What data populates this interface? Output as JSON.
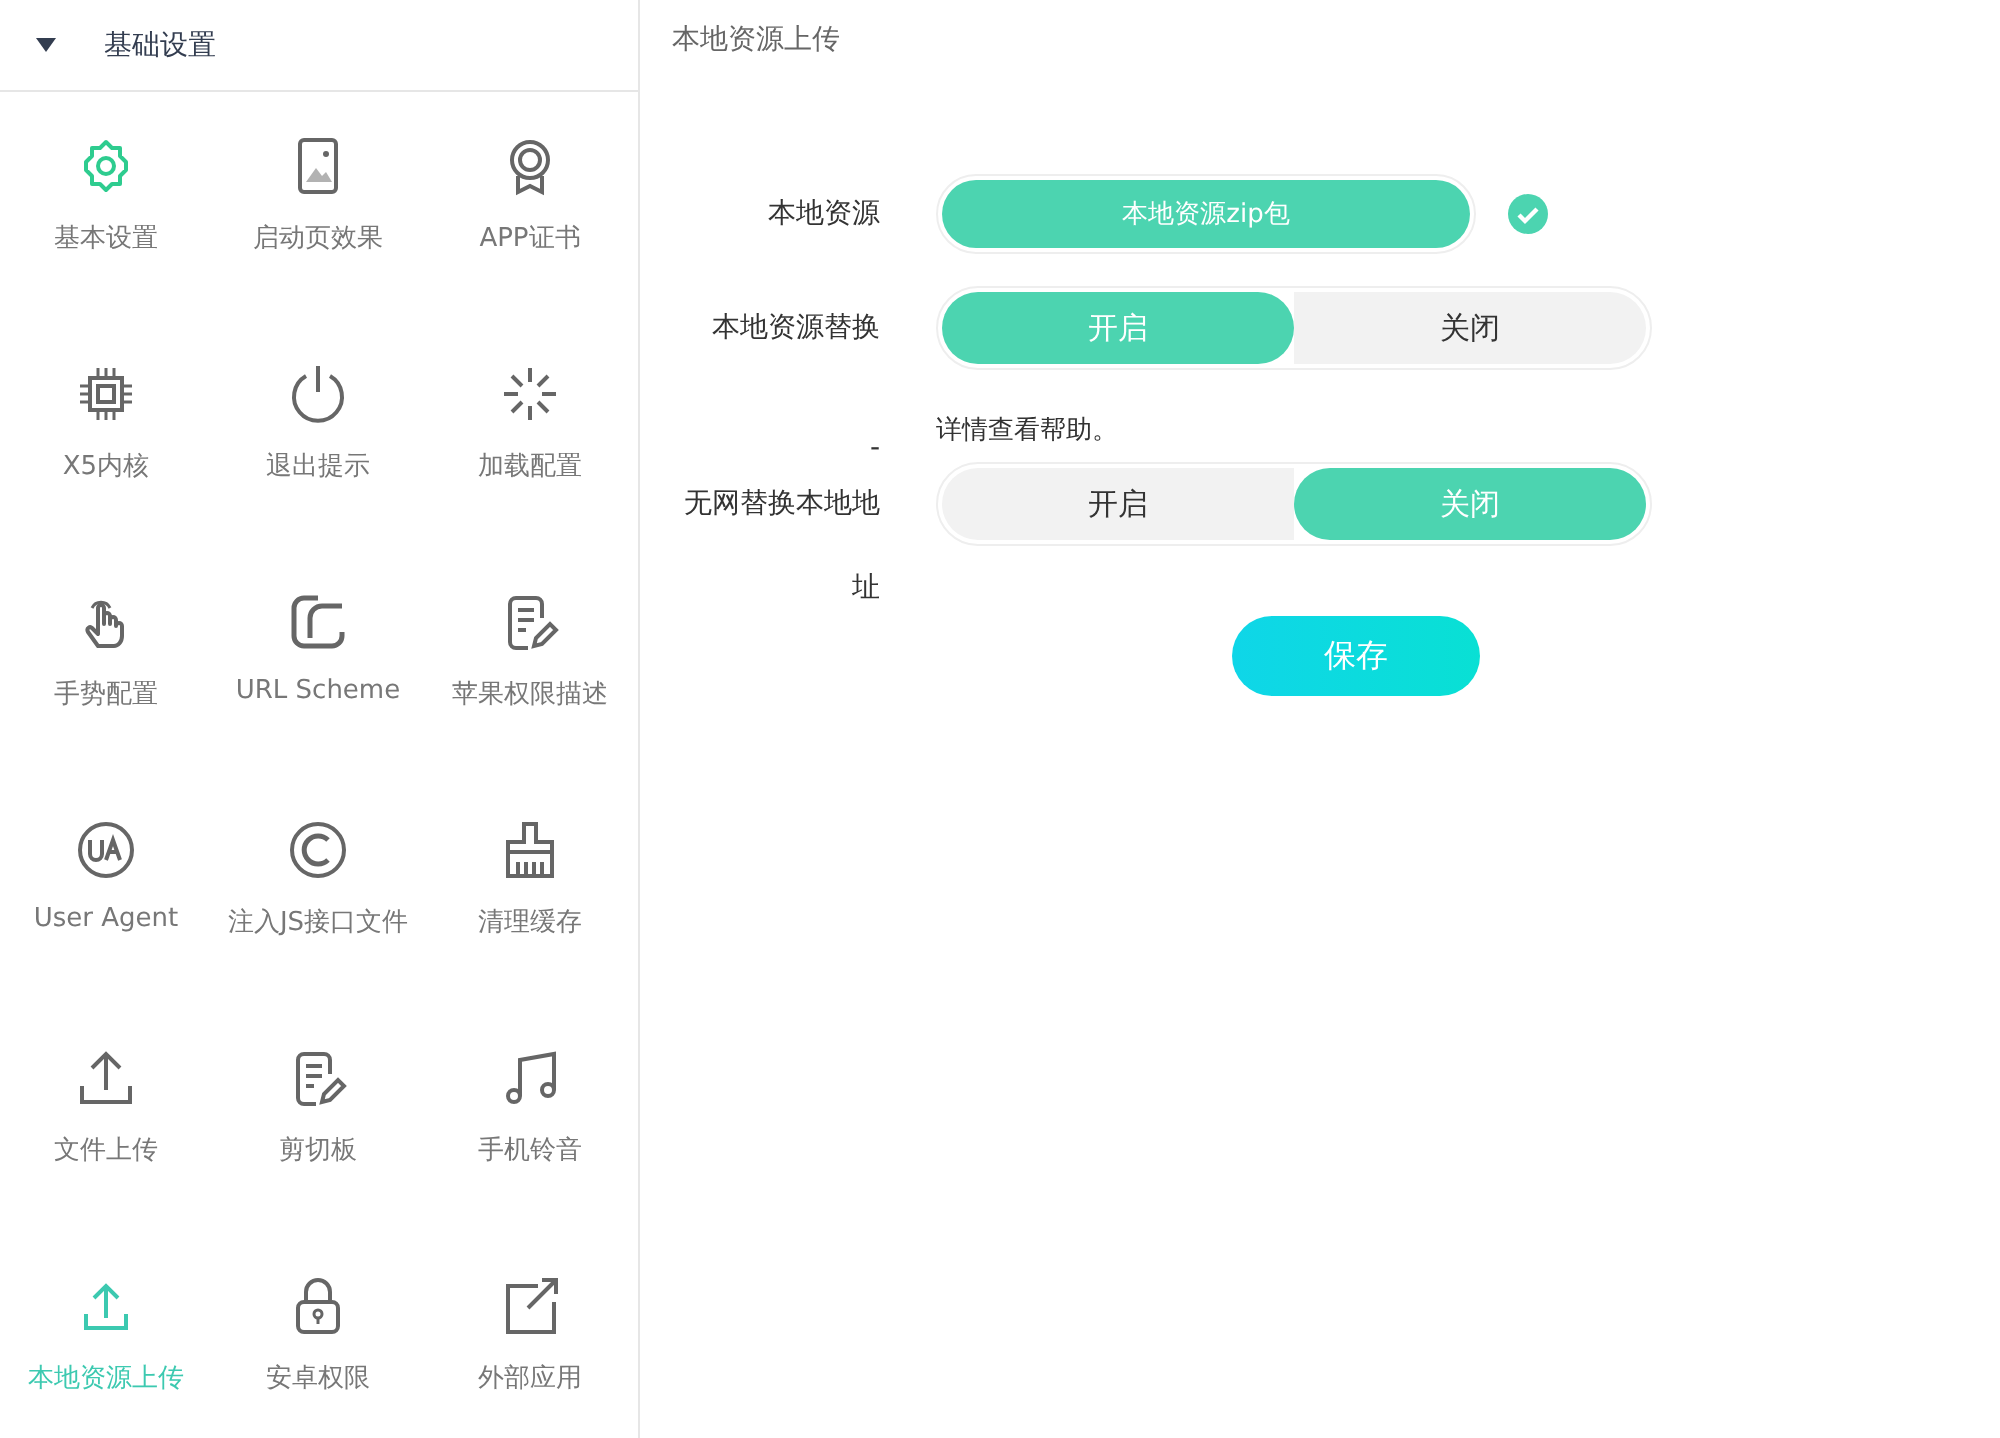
{
  "sidebar": {
    "header": {
      "label": "基础设置",
      "expanded": true
    },
    "items": [
      {
        "label": "基本设置",
        "selected": false
      },
      {
        "label": "启动页效果",
        "selected": false
      },
      {
        "label": "APP证书",
        "selected": false
      },
      {
        "label": "X5内核",
        "selected": false
      },
      {
        "label": "退出提示",
        "selected": false
      },
      {
        "label": "加载配置",
        "selected": false
      },
      {
        "label": "手势配置",
        "selected": false
      },
      {
        "label": "URL Scheme",
        "selected": false
      },
      {
        "label": "苹果权限描述",
        "selected": false
      },
      {
        "label": "User Agent",
        "selected": false
      },
      {
        "label": "注入JS接口文件",
        "selected": false
      },
      {
        "label": "清理缓存",
        "selected": false
      },
      {
        "label": "文件上传",
        "selected": false
      },
      {
        "label": "剪切板",
        "selected": false
      },
      {
        "label": "手机铃音",
        "selected": false
      },
      {
        "label": "本地资源上传",
        "selected": true
      },
      {
        "label": "安卓权限",
        "selected": false
      },
      {
        "label": "外部应用",
        "selected": false
      }
    ]
  },
  "page": {
    "title": "本地资源上传",
    "fields": [
      {
        "kind": "upload",
        "label": "本地资源",
        "button": "本地资源zip包",
        "done": true
      },
      {
        "kind": "toggle",
        "label": "本地资源替换",
        "options": [
          {
            "label": "开启",
            "selected": true
          },
          {
            "label": "关闭",
            "selected": false
          }
        ]
      },
      {
        "kind": "note",
        "label": "-",
        "text": "详情查看帮助。"
      },
      {
        "kind": "toggle",
        "label": "无网替换本地地址",
        "options": [
          {
            "label": "开启",
            "selected": false
          },
          {
            "label": "关闭",
            "selected": true
          }
        ]
      }
    ],
    "save": "保存"
  }
}
